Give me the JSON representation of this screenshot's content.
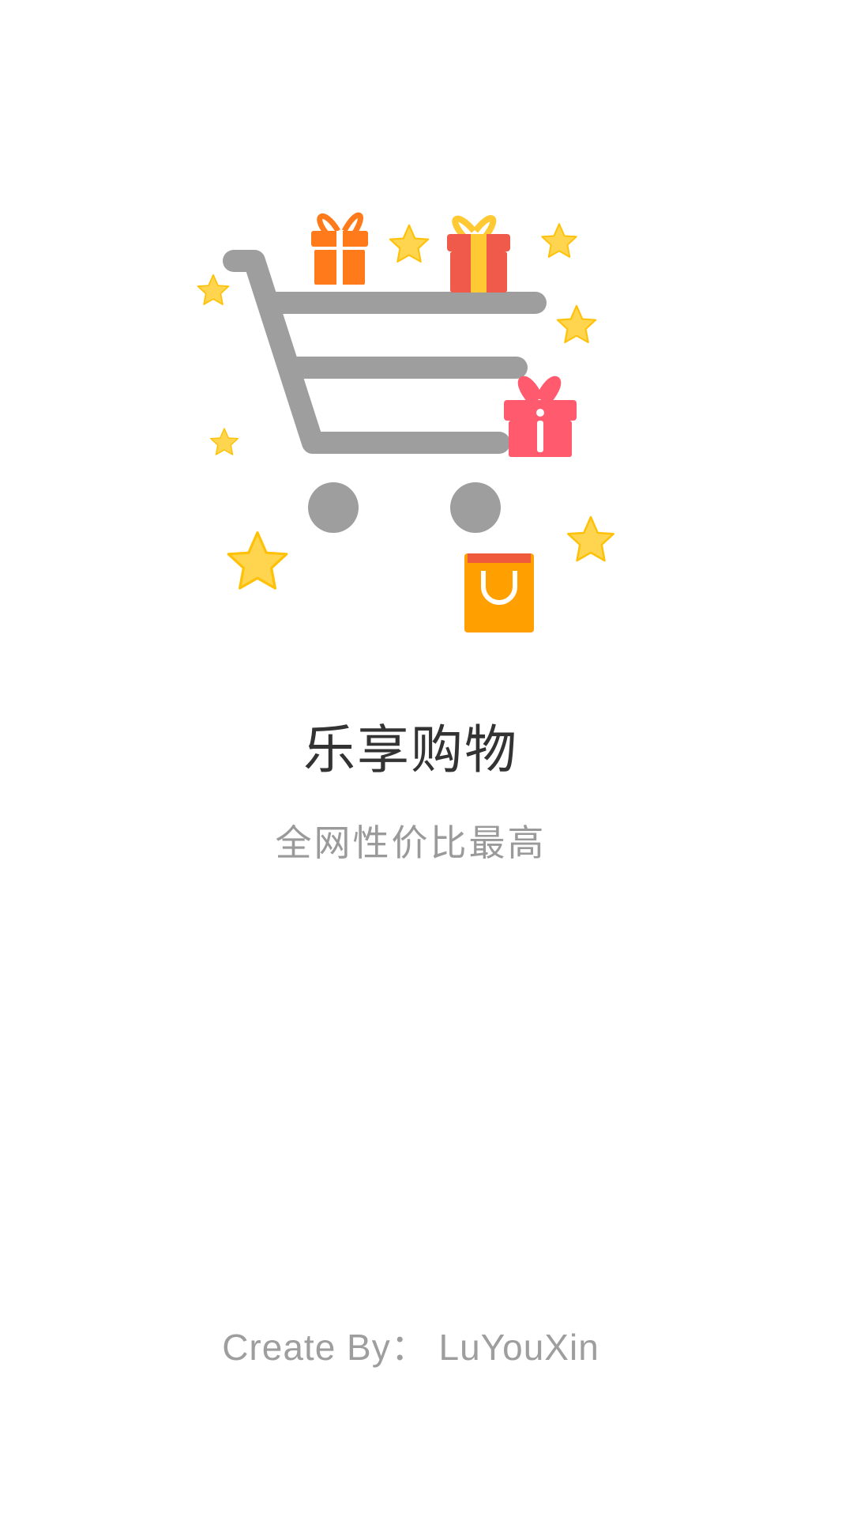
{
  "splash": {
    "title": "乐享购物",
    "subtitle": "全网性价比最高",
    "credit": "Create By：  LuYouXin"
  },
  "illustration": {
    "icons": [
      "shopping-cart-icon",
      "gift-icon",
      "star-icon",
      "shopping-bag-icon"
    ],
    "colors": {
      "cart": "#9e9e9e",
      "star": "#ffd54f",
      "gift_orange": "#ff7a1a",
      "gift_red": "#ef5a4a",
      "gift_pink": "#ff5a6e",
      "bag": "#ffa000",
      "bag_top": "#f05a3c"
    }
  }
}
